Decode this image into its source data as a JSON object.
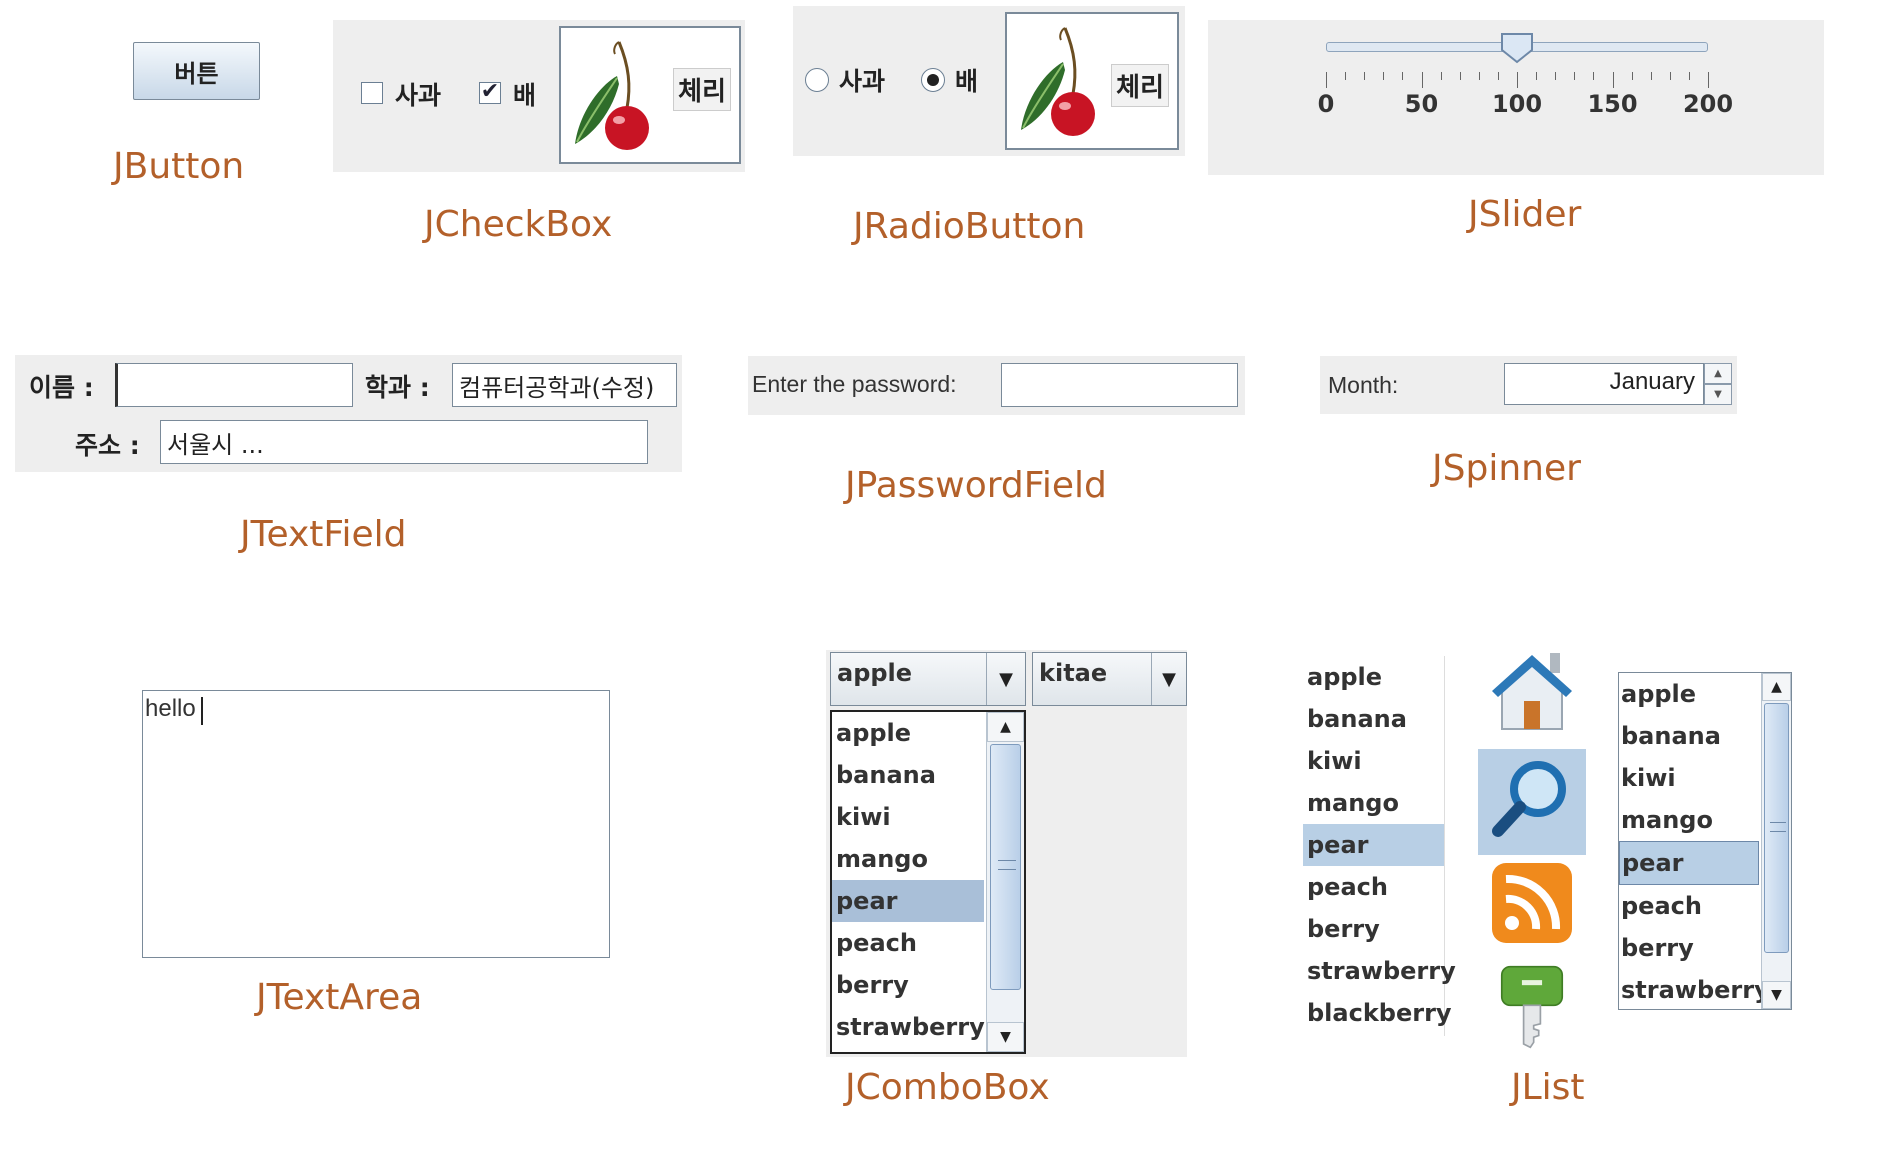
{
  "captions": {
    "jbutton": "JButton",
    "jcheckbox": "JCheckBox",
    "jradiobutton": "JRadioButton",
    "jslider": "JSlider",
    "jtextfield": "JTextField",
    "jpasswordfield": "JPasswordField",
    "jspinner": "JSpinner",
    "jtextarea": "JTextArea",
    "jcombobox": "JComboBox",
    "jlist": "JList"
  },
  "button": {
    "label": "버튼"
  },
  "checkbox": {
    "apple_label": "사과",
    "apple_checked": false,
    "pear_label": "배",
    "pear_checked": true,
    "cherry_label": "체리",
    "check_mark": "✔"
  },
  "radio": {
    "apple_label": "사과",
    "apple_selected": false,
    "pear_label": "배",
    "pear_selected": true,
    "cherry_label": "체리"
  },
  "slider": {
    "min": 0,
    "max": 200,
    "value": 100,
    "major_ticks": [
      "0",
      "50",
      "100",
      "150",
      "200"
    ]
  },
  "textfield": {
    "name_label": "이름 :",
    "name_value": "",
    "dept_label": "학과 :",
    "dept_value": "컴퓨터공학과(수정)",
    "addr_label": "주소 :",
    "addr_value": "서울시 ..."
  },
  "password": {
    "label": "Enter the password:",
    "value": ""
  },
  "spinner": {
    "label": "Month:",
    "value": "January"
  },
  "textarea": {
    "value": "hello"
  },
  "combobox": {
    "fruit_selected": "apple",
    "name_selected": "kitae",
    "items": [
      "apple",
      "banana",
      "kiwi",
      "mango",
      "pear",
      "peach",
      "berry",
      "strawberry"
    ],
    "highlighted_index": 4
  },
  "list1": {
    "items": [
      "apple",
      "banana",
      "kiwi",
      "mango",
      "pear",
      "peach",
      "berry",
      "strawberry",
      "blackberry"
    ],
    "selected_index": 4
  },
  "icon_list": {
    "icons": [
      "home-icon",
      "search-icon",
      "rss-icon",
      "key-icon"
    ],
    "selected_index": 1
  },
  "list3": {
    "items": [
      "apple",
      "banana",
      "kiwi",
      "mango",
      "pear",
      "peach",
      "berry",
      "strawberry"
    ],
    "selected_index": 4
  },
  "colors": {
    "caption": "#b3602a",
    "panel": "#eeeeee",
    "selection": "#b8cfe5"
  }
}
